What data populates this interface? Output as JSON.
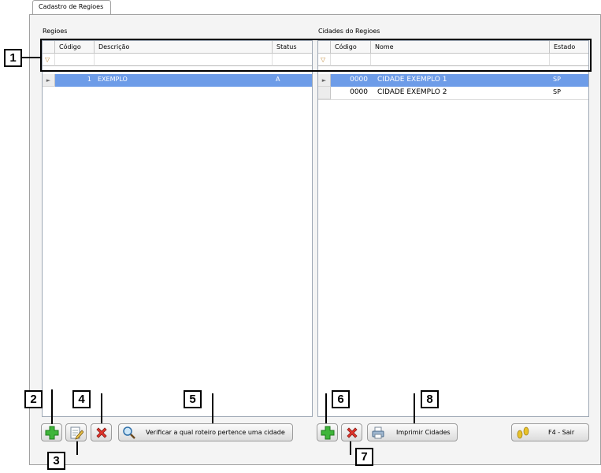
{
  "window": {
    "tab_title": "Cadastro de Regioes"
  },
  "regioes": {
    "title": "Regioes",
    "columns": [
      "Código",
      "Descrição",
      "Status"
    ],
    "rows": [
      {
        "codigo": "1",
        "descricao": "EXEMPLO",
        "status": "A"
      }
    ]
  },
  "cidades": {
    "title": "Cidades do Regioes",
    "columns": [
      "Código",
      "Nome",
      "Estado"
    ],
    "rows": [
      {
        "codigo": "0000",
        "nome": "CIDADE EXEMPLO 1",
        "estado": "SP"
      },
      {
        "codigo": "0000",
        "nome": "CIDADE EXEMPLO 2",
        "estado": "SP"
      }
    ]
  },
  "toolbar": {
    "verificar_label": "Verificar a qual roteiro pertence uma cidade",
    "imprimir_label": "Imprimir Cidades",
    "sair_label": "F4 - Sair"
  },
  "callouts": [
    "1",
    "2",
    "3",
    "4",
    "5",
    "6",
    "7",
    "8"
  ],
  "colors": {
    "selection": "#6d9ce8",
    "add_green": "#3fb53a",
    "delete_red": "#e2342b",
    "callout_border": "#000000"
  }
}
